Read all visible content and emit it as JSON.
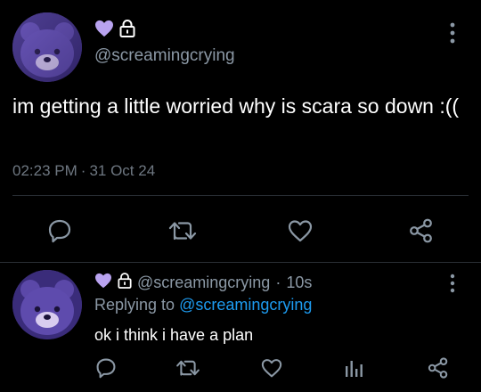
{
  "main_tweet": {
    "handle": "@screamingcrying",
    "text": "im getting a little worried why is scara so down :((",
    "time": "02:23 PM",
    "separator": "·",
    "date": "31 Oct 24"
  },
  "reply": {
    "handle": "@screamingcrying",
    "separator": "·",
    "age": "10s",
    "replying_prefix": "Replying to",
    "replying_handle": "@screamingcrying",
    "text": "ok i think i have a plan"
  },
  "colors": {
    "background": "#000000",
    "secondary_text": "#8b98a5",
    "link": "#1d9bf0",
    "heart_badge": "#b9a3f0",
    "divider": "#2a2f35"
  },
  "icons": {
    "reply": "speech-bubble-icon",
    "retweet": "retweet-icon",
    "like": "heart-icon",
    "share": "share-icon",
    "stats": "bar-chart-icon",
    "more": "vertical-dots-icon",
    "verified_heart": "heart-badge-icon",
    "locked": "lock-icon"
  }
}
